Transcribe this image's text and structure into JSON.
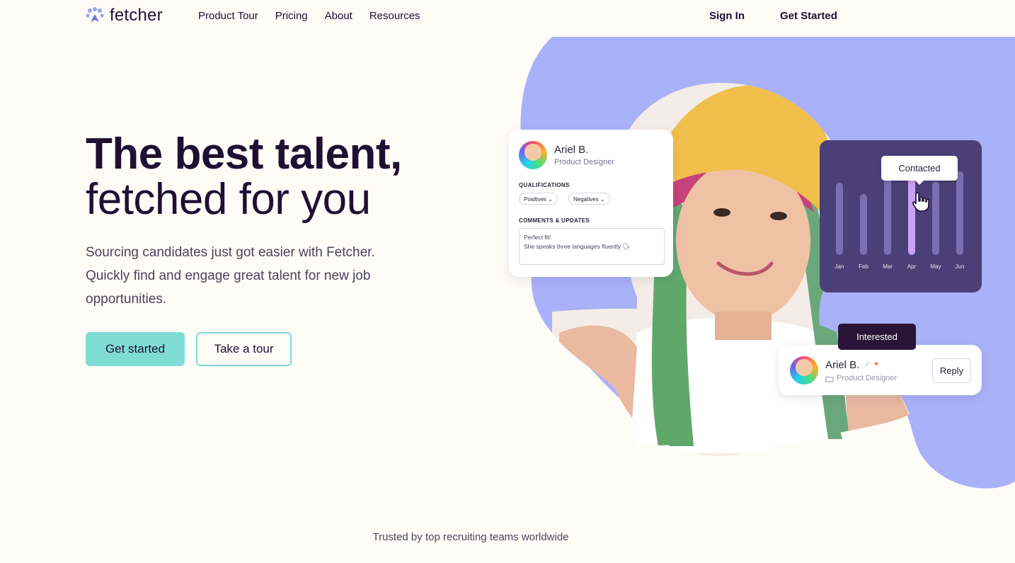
{
  "nav": {
    "logo_text": "fetcher",
    "links": [
      "Product Tour",
      "Pricing",
      "About",
      "Resources"
    ],
    "sign_in": "Sign In",
    "get_started": "Get Started"
  },
  "hero": {
    "title_line1": "The best talent,",
    "title_line2": "fetched for you",
    "subtitle": "Sourcing candidates just got easier with Fetcher. Quickly find and engage great talent for new job opportunities.",
    "primary_cta": "Get started",
    "secondary_cta": "Take a tour"
  },
  "profile_card": {
    "name": "Ariel B.",
    "role": "Product Designer",
    "qualifications_label": "QUALIFICATIONS",
    "chips": [
      "Positives",
      "Negatives"
    ],
    "comments_label": "COMMENTS & UPDATES",
    "comment_line1": "Perfect fit!",
    "comment_line2": "She speaks three languages fluently 🗣"
  },
  "activity_chart": {
    "tooltip": "Contacted",
    "months": [
      "Jan",
      "Feb",
      "Mar",
      "Apr",
      "May",
      "Jun"
    ],
    "highlighted": "Apr"
  },
  "reply_card": {
    "status": "Interested",
    "name": "Ariel B.",
    "role": "Product Designer",
    "reply_label": "Reply"
  },
  "footer_note": "Trusted by top recruiting teams worldwide",
  "colors": {
    "accent": "#7fdcd5",
    "blob": "#a9b1f8",
    "chart_bg": "#4b3f77",
    "dark": "#1f1033"
  }
}
